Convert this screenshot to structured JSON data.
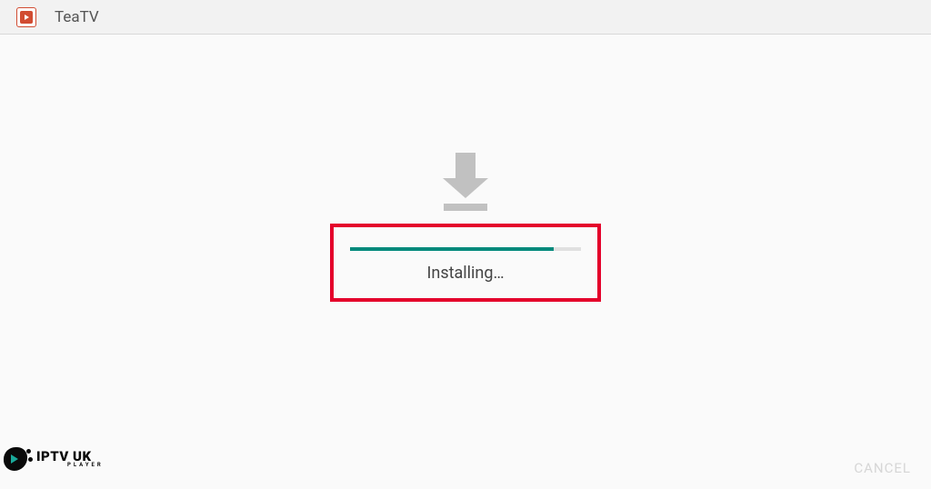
{
  "header": {
    "app_title": "TeaTV"
  },
  "install": {
    "status_label": "Installing…",
    "progress_percent": 88,
    "cancel_label": "CANCEL"
  },
  "watermark": {
    "line1": "IPTV UK",
    "line2": "PLAYER"
  },
  "colors": {
    "accent": "#00897b",
    "highlight_box": "#e4002b"
  }
}
